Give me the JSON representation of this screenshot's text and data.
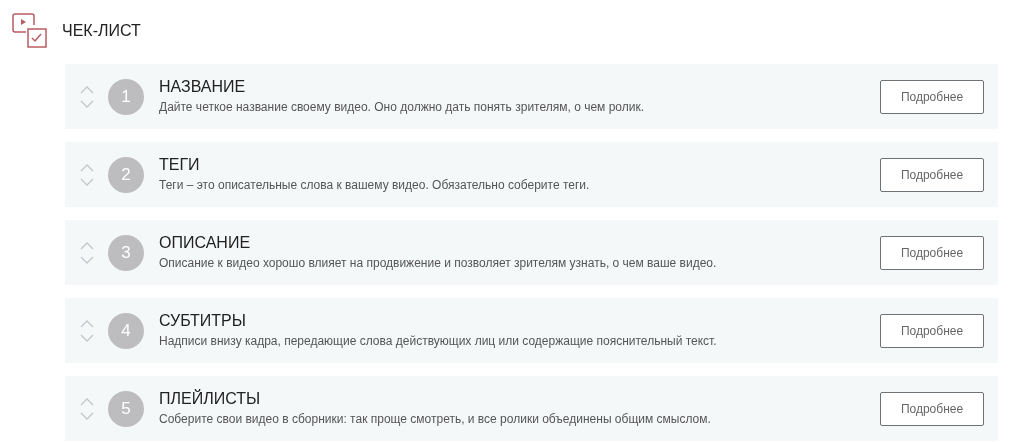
{
  "title": "ЧЕК-ЛИСТ",
  "items": [
    {
      "number": "1",
      "title": "НАЗВАНИЕ",
      "description": "Дайте четкое название своему видео. Оно должно дать понять зрителям, о чем ролик.",
      "button": "Подробнее"
    },
    {
      "number": "2",
      "title": "ТЕГИ",
      "description": "Теги – это описательные слова к вашему видео. Обязательно соберите теги.",
      "button": "Подробнее"
    },
    {
      "number": "3",
      "title": "ОПИСАНИЕ",
      "description": "Описание к видео хорошо влияет на продвижение и позволяет зрителям узнать, о чем ваше видео.",
      "button": "Подробнее"
    },
    {
      "number": "4",
      "title": "СУБТИТРЫ",
      "description": "Надписи внизу кадра, передающие слова действующих лиц или содержащие пояснительный текст.",
      "button": "Подробнее"
    },
    {
      "number": "5",
      "title": "ПЛЕЙЛИСТЫ",
      "description": "Соберите свои видео в сборники: так проще смотреть, и все ролики объединены общим смыслом.",
      "button": "Подробнее"
    }
  ]
}
